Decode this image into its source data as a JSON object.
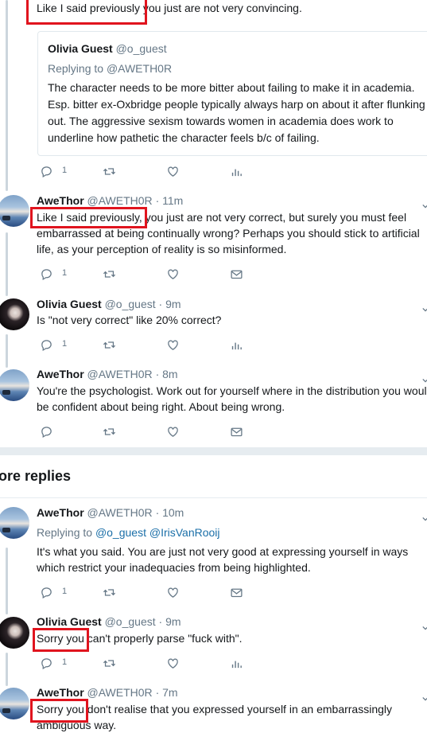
{
  "tweets": [
    {
      "text_lines": [
        "Like I said previously you just are not very convincing."
      ],
      "quote": {
        "name": "Olivia Guest",
        "handle": "@o_guest",
        "replying_label": "Replying to",
        "replying_to": "@AWETH0R",
        "text_lines": [
          "The character needs to be more bitter about failing to make it in academia.",
          "Esp. bitter ex-Oxbridge people typically always harp on about it after flunking",
          "out. The aggressive sexism towards women in academia does work to",
          "underline how pathetic the character feels b/c of failing."
        ]
      },
      "reply_count": "1"
    },
    {
      "name": "AweThor",
      "handle": "@AWETH0R",
      "time": "· 11m",
      "text_lines": [
        "Like I said previously, you just are not very correct, but surely you must feel",
        "embarrassed at being continually wrong? Perhaps you should stick to artificial",
        "life, as your perception of reality is so misinformed."
      ],
      "reply_count": "1"
    },
    {
      "name": "Olivia Guest",
      "handle": "@o_guest",
      "time": "· 9m",
      "text_lines": [
        "Is \"not very correct\" like 20% correct?"
      ],
      "reply_count": "1"
    },
    {
      "name": "AweThor",
      "handle": "@AWETH0R",
      "time": "· 8m",
      "text_lines": [
        "You're the psychologist. Work out for yourself where in the distribution you would",
        "be confident about being right. About being wrong."
      ]
    }
  ],
  "section_title": "ore replies",
  "replies": [
    {
      "name": "AweThor",
      "handle": "@AWETH0R",
      "time": "· 10m",
      "replying_label": "Replying to",
      "replying_to": [
        "@o_guest",
        "@IrisVanRooij"
      ],
      "text_lines": [
        "It's what you said. You are just not very good at expressing yourself in ways",
        "which restrict your inadequacies from being highlighted."
      ],
      "reply_count": "1"
    },
    {
      "name": "Olivia Guest",
      "handle": "@o_guest",
      "time": "· 9m",
      "text_lines": [
        "Sorry you can't properly parse \"fuck with\"."
      ],
      "reply_count": "1"
    },
    {
      "name": "AweThor",
      "handle": "@AWETH0R",
      "time": "· 7m",
      "text_lines": [
        "Sorry you don't realise that you expressed yourself in an embarrassingly",
        "ambiguous way."
      ]
    }
  ],
  "icons": {
    "reply": "reply-icon",
    "retweet": "retweet-icon",
    "like": "heart-icon",
    "analytics": "analytics-icon",
    "dm": "envelope-icon",
    "more": "chevron-down-icon"
  },
  "colors": {
    "highlight": "#e0141e",
    "link": "#1b6fa8",
    "muted": "#657786"
  }
}
